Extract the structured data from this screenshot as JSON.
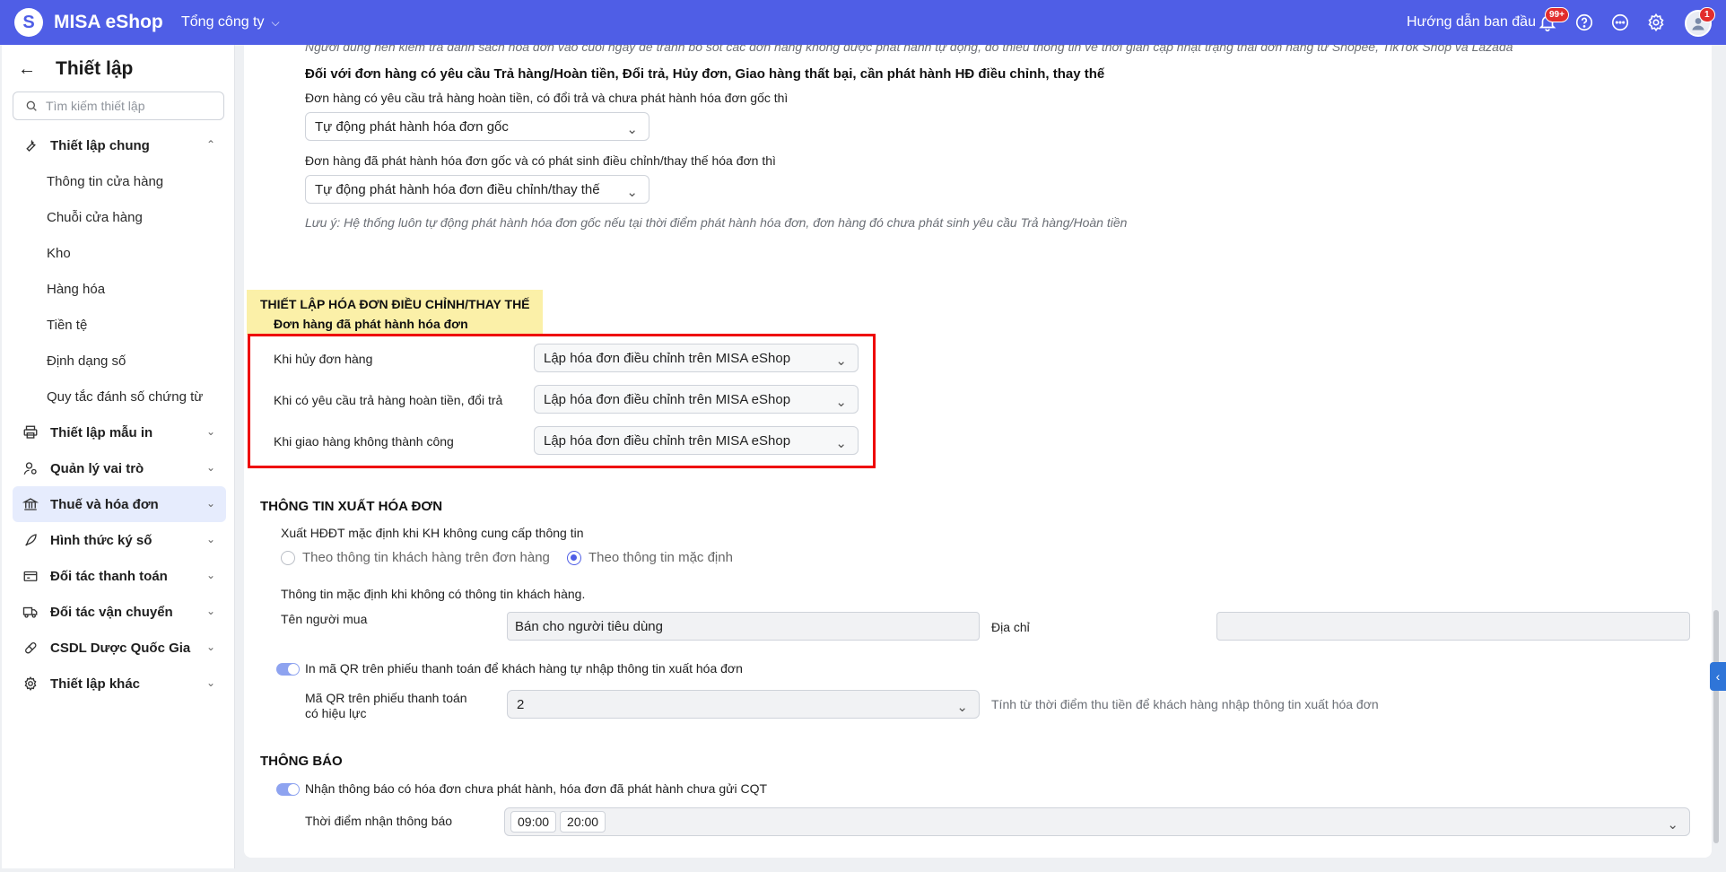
{
  "topbar": {
    "logo_letter": "S",
    "app_name": "MISA eShop",
    "company": "Tổng công ty",
    "guide": "Hướng dẫn ban đầu",
    "notif_badge": "99+",
    "avatar_badge": "1",
    "brand_color": "#4f5ee6"
  },
  "sidebar": {
    "title": "Thiết lập",
    "search_placeholder": "Tìm kiếm thiết lập",
    "groups": [
      {
        "label": "Thiết lập chung",
        "icon": "tools-icon",
        "expanded": true,
        "children": [
          "Thông tin cửa hàng",
          "Chuỗi cửa hàng",
          "Kho",
          "Hàng hóa",
          "Tiền tệ",
          "Định dạng số",
          "Quy tắc đánh số chứng từ"
        ]
      },
      {
        "label": "Thiết lập mẫu in",
        "icon": "printer-icon"
      },
      {
        "label": "Quản lý vai trò",
        "icon": "user-role-icon"
      },
      {
        "label": "Thuế và hóa đơn",
        "icon": "bank-icon",
        "active": true
      },
      {
        "label": "Hình thức ký số",
        "icon": "pen-icon"
      },
      {
        "label": "Đối tác thanh toán",
        "icon": "wallet-icon"
      },
      {
        "label": "Đối tác vận chuyển",
        "icon": "truck-icon"
      },
      {
        "label": "CSDL Dược Quốc Gia",
        "icon": "pill-icon"
      },
      {
        "label": "Thiết lập khác",
        "icon": "gear-icon"
      }
    ]
  },
  "main": {
    "top_note": "Người dùng nên kiểm tra danh sách hóa đơn vào cuối ngày để tránh bỏ sót các đơn hàng không được phát hành tự động, do thiếu thông tin về thời gian cập nhật trạng thái đơn hàng từ Shopee, TikTok Shop và Lazada",
    "return_heading": "Đối với đơn hàng có yêu cầu Trả hàng/Hoàn tiền, Đổi trả, Hủy đơn, Giao hàng thất bại, cần phát hành HĐ điều chỉnh, thay thế",
    "q1_label": "Đơn hàng có yêu cầu trả hàng hoàn tiền, có đổi trả và chưa phát hành hóa đơn gốc thì",
    "q1_value": "Tự động phát hành hóa đơn gốc",
    "q2_label": "Đơn hàng đã phát hành hóa đơn gốc và có phát sinh điều chỉnh/thay thế hóa đơn thì",
    "q2_value": "Tự động phát hành hóa đơn điều chỉnh/thay thế",
    "note": "Lưu ý: Hệ thống luôn tự động phát hành hóa đơn gốc nếu tại thời điểm phát hành hóa đơn, đơn hàng đó chưa phát sinh yêu cầu Trả hàng/Hoàn tiền",
    "adjust_section": {
      "title": "THIẾT LẬP HÓA ĐƠN ĐIỀU CHỈNH/THAY THẾ",
      "subtitle": "Đơn hàng đã phát hành hóa đơn",
      "rows": [
        {
          "label": "Khi hủy đơn hàng",
          "value": "Lập hóa đơn điều chỉnh trên MISA eShop"
        },
        {
          "label": "Khi có yêu cầu trả hàng hoàn tiền, đổi trả",
          "value": "Lập hóa đơn điều chỉnh trên MISA eShop"
        },
        {
          "label": "Khi giao hàng không thành công",
          "value": "Lập hóa đơn điều chỉnh trên MISA eShop"
        }
      ]
    },
    "export_section": {
      "title": "THÔNG TIN XUẤT HÓA ĐƠN",
      "default_label": "Xuất HĐĐT mặc định khi KH không cung cấp thông tin",
      "radio1": "Theo thông tin khách hàng trên đơn hàng",
      "radio2": "Theo thông tin mặc định",
      "default_info_label": "Thông tin mặc định khi không có thông tin khách hàng.",
      "buyer_label": "Tên người mua",
      "buyer_value": "Bán cho người tiêu dùng",
      "address_label": "Địa chỉ",
      "address_value": "",
      "qr_toggle_label": "In mã QR trên phiếu thanh toán để khách hàng tự nhập thông tin xuất hóa đơn",
      "qr_validity_label_1": "Mã QR trên phiếu thanh toán",
      "qr_validity_label_2": "có hiệu lực",
      "qr_validity_value": "2",
      "qr_hint": "Tính từ thời điểm thu tiền để khách hàng nhập thông tin xuất hóa đơn"
    },
    "notify_section": {
      "title": "THÔNG BÁO",
      "toggle_label": "Nhận thông báo có hóa đơn chưa phát hành, hóa đơn đã phát hành chưa gửi CQT",
      "time_label": "Thời điểm nhận thông báo",
      "times": [
        "09:00",
        "20:00"
      ]
    }
  }
}
